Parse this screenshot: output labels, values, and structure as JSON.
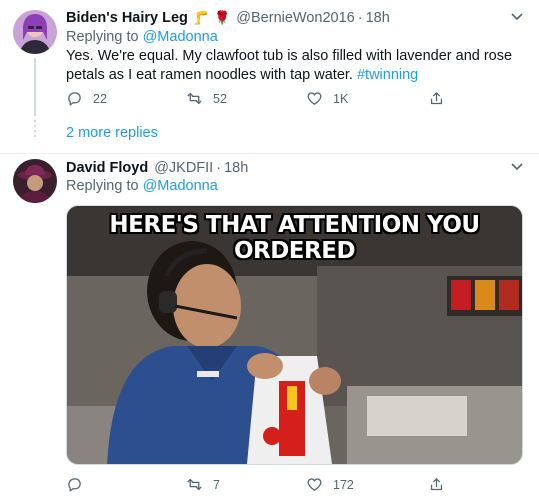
{
  "tweet1": {
    "display_name": "Biden's Hairy Leg",
    "emojis": [
      "🦵",
      "🌹"
    ],
    "handle": "@BernieWon2016",
    "separator": "·",
    "time": "18h",
    "replying_prefix": "Replying to",
    "replying_to": "@Madonna",
    "text": "Yes. We're equal. My clawfoot tub is also filled with lavender and rose petals as I eat ramen noodles with tap water.",
    "hashtag": "#twinning",
    "reply_count": "22",
    "retweet_count": "52",
    "like_count": "1K",
    "more_replies": "2 more replies"
  },
  "tweet2": {
    "display_name": "David Floyd",
    "handle": "@JKDFII",
    "separator": "·",
    "time": "18h",
    "replying_prefix": "Replying to",
    "replying_to": "@Madonna",
    "meme_caption": "HERE'S THAT ATTENTION YOU ORDERED",
    "reply_count": "",
    "retweet_count": "7",
    "like_count": "172"
  },
  "icons": {
    "reply": "reply-icon",
    "retweet": "retweet-icon",
    "like": "heart-icon",
    "share": "share-icon",
    "more": "chevron-down-icon"
  },
  "colors": {
    "link": "#1d9bf0",
    "muted": "#536471",
    "text": "#0f1419"
  }
}
